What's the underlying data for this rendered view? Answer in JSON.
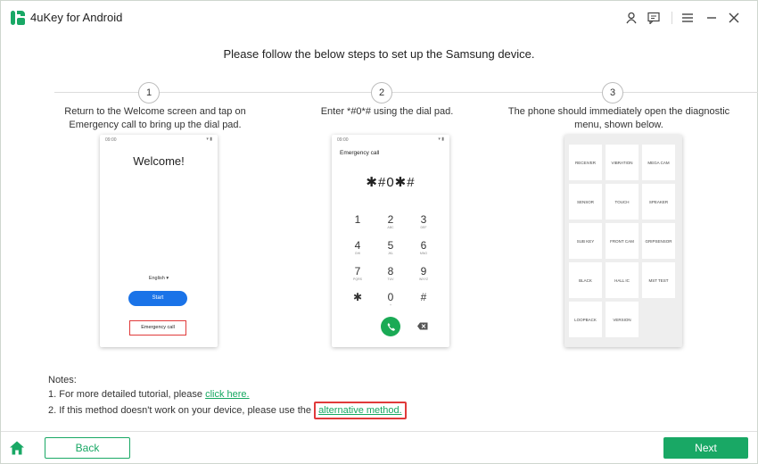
{
  "app": {
    "title": "4uKey for Android",
    "brand_color": "#19a865"
  },
  "titlebar": {
    "icons": [
      "user-icon",
      "feedback-icon",
      "menu-icon",
      "minimize-icon",
      "close-icon"
    ]
  },
  "main": {
    "heading": "Please follow the below steps to set up the Samsung device.",
    "steps": [
      {
        "num": "1",
        "desc": "Return to the Welcome screen and tap on Emergency call to bring up the dial pad."
      },
      {
        "num": "2",
        "desc": "Enter *#0*# using the dial pad."
      },
      {
        "num": "3",
        "desc": "The phone should immediately open the diagnostic menu, shown below."
      }
    ]
  },
  "phone1": {
    "status_time": "09:00",
    "welcome": "Welcome!",
    "language": "English",
    "start": "Start",
    "emergency": "Emergency call"
  },
  "phone2": {
    "status_time": "09:00",
    "title": "Emergency call",
    "display": "✱#0✱#",
    "keys": [
      {
        "d": "1",
        "l": ""
      },
      {
        "d": "2",
        "l": "ABC"
      },
      {
        "d": "3",
        "l": "DEF"
      },
      {
        "d": "4",
        "l": "GHI"
      },
      {
        "d": "5",
        "l": "JKL"
      },
      {
        "d": "6",
        "l": "MNO"
      },
      {
        "d": "7",
        "l": "PQRS"
      },
      {
        "d": "8",
        "l": "TUV"
      },
      {
        "d": "9",
        "l": "WXYZ"
      },
      {
        "d": "✱",
        "l": ""
      },
      {
        "d": "0",
        "l": "+"
      },
      {
        "d": "#",
        "l": ""
      }
    ]
  },
  "phone3": {
    "cells": [
      "RECEIVER",
      "VIBRATION",
      "MEGA CAM",
      "SENSOR",
      "TOUCH",
      "SPEAKER",
      "SUB KEY",
      "FRONT CAM",
      "GRIPSENSOR",
      "BLACK",
      "HALL IC",
      "MST TEST",
      "LOOPBACK",
      "VERSION"
    ]
  },
  "notes": {
    "title": "Notes:",
    "line1_prefix": "1. For more detailed tutorial, please ",
    "line1_link": "click here.",
    "line2_prefix": "2. If this method doesn't work on your device, please use the ",
    "line2_link": "alternative method."
  },
  "footer": {
    "back": "Back",
    "next": "Next"
  }
}
